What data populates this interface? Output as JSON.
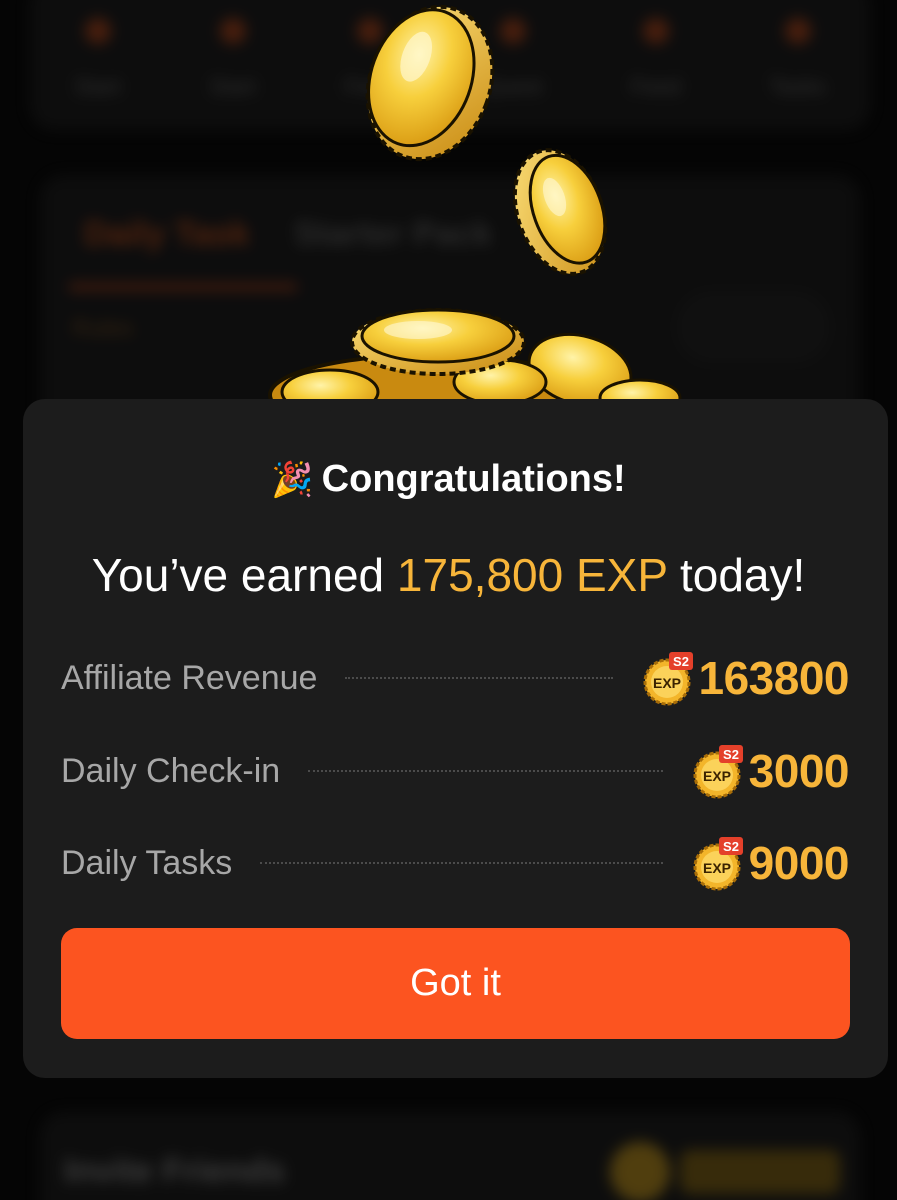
{
  "background": {
    "nav_items": [
      "Start",
      "Start",
      "Feed",
      "Quest",
      "Feed",
      "Tasks"
    ],
    "tabs": [
      "Daily Task",
      "Starter Pack"
    ],
    "link_text": "Rules",
    "bottom_title": "Invite Friends"
  },
  "modal": {
    "title_emoji": "🎉",
    "title": "Congratulations!",
    "headline_prefix": "You’ve earned ",
    "headline_amount": "175,800 EXP",
    "headline_suffix": " today!",
    "rows": [
      {
        "label": "Affiliate Revenue",
        "badge_text": "EXP",
        "badge_season": "S2",
        "value": "163800"
      },
      {
        "label": "Daily Check-in",
        "badge_text": "EXP",
        "badge_season": "S2",
        "value": "3000"
      },
      {
        "label": "Daily Tasks",
        "badge_text": "EXP",
        "badge_season": "S2",
        "value": "9000"
      }
    ],
    "button_label": "Got it"
  },
  "colors": {
    "accent": "#f7b53a",
    "button": "#fc5420",
    "modal_bg": "#1c1c1c",
    "muted_text": "#a7a7a7"
  },
  "icons": [
    "party-popper-icon",
    "exp-s2-badge-icon",
    "gold-coin-icon"
  ]
}
